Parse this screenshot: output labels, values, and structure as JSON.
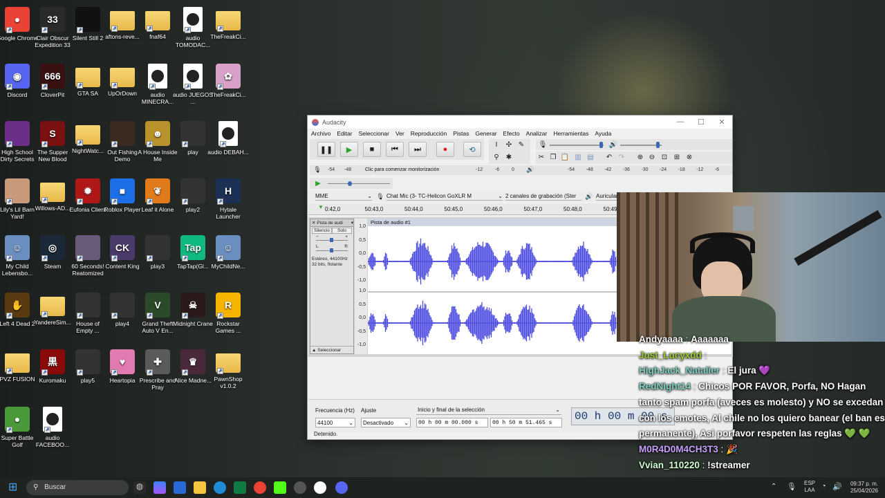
{
  "desktop": {
    "icons": [
      {
        "label": "Google Chrome",
        "glyph": "●",
        "color": "#ea4335"
      },
      {
        "label": "Clair Obscur Expedition 33",
        "glyph": "33",
        "color": "#2a2a2a"
      },
      {
        "label": "Silent Still 2",
        "glyph": "",
        "color": "#111111"
      },
      {
        "label": "aftons-reve...",
        "glyph": "",
        "color": "folder"
      },
      {
        "label": "fnaf64",
        "glyph": "",
        "color": "folder"
      },
      {
        "label": "audio TOMODAC...",
        "glyph": "",
        "color": "audio"
      },
      {
        "label": "TheFreakCi...",
        "glyph": "",
        "color": "folder"
      },
      {
        "label": "Discord",
        "glyph": "◉",
        "color": "#5865f2"
      },
      {
        "label": "CloverPit",
        "glyph": "666",
        "color": "#3a1111"
      },
      {
        "label": "GTA SA",
        "glyph": "",
        "color": "folder"
      },
      {
        "label": "UpOrDown",
        "glyph": "",
        "color": "folder"
      },
      {
        "label": "audio MINECRA...",
        "glyph": "",
        "color": "audio"
      },
      {
        "label": "audio JUEGOS ...",
        "glyph": "",
        "color": "audio"
      },
      {
        "label": "TheFreakCi...",
        "glyph": "✿",
        "color": "#d9a0c8"
      },
      {
        "label": "High School Dirty Secrets",
        "glyph": "",
        "color": "#6b2f8a"
      },
      {
        "label": "The Supper New Blood",
        "glyph": "S",
        "color": "#7a1010"
      },
      {
        "label": "NightWatc...",
        "glyph": "",
        "color": "folder"
      },
      {
        "label": "Out Fishing Demo",
        "glyph": "",
        "color": "#3a2a20"
      },
      {
        "label": "A House Inside Me",
        "glyph": "☻",
        "color": "#b8922a"
      },
      {
        "label": "play",
        "glyph": "",
        "color": "#333"
      },
      {
        "label": "audio DEBAH...",
        "glyph": "",
        "color": "audio"
      },
      {
        "label": "Lily's Lil Barn Yard!",
        "glyph": "",
        "color": "#c89a7a"
      },
      {
        "label": "Willows-AD...",
        "glyph": "",
        "color": "folder"
      },
      {
        "label": "Eufonia Client",
        "glyph": "✹",
        "color": "#b01818"
      },
      {
        "label": "Roblox Player",
        "glyph": "■",
        "color": "#1d6fe8"
      },
      {
        "label": "Leaf it Alone",
        "glyph": "❦",
        "color": "#e07a1a"
      },
      {
        "label": "play2",
        "glyph": "",
        "color": "#333"
      },
      {
        "label": "Hytale Launcher",
        "glyph": "H",
        "color": "#1c2f55"
      },
      {
        "label": "My Child Lebensbo...",
        "glyph": "☺",
        "color": "#6a8ec0"
      },
      {
        "label": "Steam",
        "glyph": "◎",
        "color": "#1b2838"
      },
      {
        "label": "60 Seconds! Reatomized",
        "glyph": "",
        "color": "#6a5a7a"
      },
      {
        "label": "Content King",
        "glyph": "CK",
        "color": "#4a3a6a"
      },
      {
        "label": "play3",
        "glyph": "",
        "color": "#333"
      },
      {
        "label": "TapTap(Gl...",
        "glyph": "Tap",
        "color": "#10b981"
      },
      {
        "label": "MyChildNe...",
        "glyph": "☺",
        "color": "#6a8ec0"
      },
      {
        "label": "Left 4 Dead 2",
        "glyph": "✋",
        "color": "#5a3a10"
      },
      {
        "label": "YandereSim...",
        "glyph": "",
        "color": "folder"
      },
      {
        "label": "House of Empty ...",
        "glyph": "",
        "color": "#333"
      },
      {
        "label": "play4",
        "glyph": "",
        "color": "#333"
      },
      {
        "label": "Grand Theft Auto V En...",
        "glyph": "V",
        "color": "#2a4a2a"
      },
      {
        "label": "Midnight Crane",
        "glyph": "☠",
        "color": "#2a1a1a"
      },
      {
        "label": "Rockstar Games ...",
        "glyph": "R",
        "color": "#f5b400"
      },
      {
        "label": "PVZ FUSION",
        "glyph": "",
        "color": "folder"
      },
      {
        "label": "Kuromaku",
        "glyph": "黒",
        "color": "#8a0a0a"
      },
      {
        "label": "play5",
        "glyph": "",
        "color": "#333"
      },
      {
        "label": "Heartopia",
        "glyph": "♥",
        "color": "#e07ab0"
      },
      {
        "label": "Prescribe and Pray",
        "glyph": "✚",
        "color": "#5a5a5a"
      },
      {
        "label": "Alice Madne...",
        "glyph": "♛",
        "color": "#4a2a3a"
      },
      {
        "label": "PawnShop v1.0.2",
        "glyph": "",
        "color": "folder"
      },
      {
        "label": "Super Battle Golf",
        "glyph": "●",
        "color": "#4a9a3a"
      },
      {
        "label": "audio FACEBOO...",
        "glyph": "",
        "color": "audio"
      }
    ]
  },
  "audacity": {
    "title": "Audacity",
    "menu": [
      "Archivo",
      "Editar",
      "Seleccionar",
      "Ver",
      "Reproducción",
      "Pistas",
      "Generar",
      "Efecto",
      "Analizar",
      "Herramientas",
      "Ayuda"
    ],
    "meter_hint": "Clic para comenzar monitorización",
    "rec_meter_ticks": [
      "-54",
      "-48",
      "-12",
      "-6",
      "0"
    ],
    "play_meter_ticks": [
      "-54",
      "-48",
      "-42",
      "-36",
      "-30",
      "-24",
      "-18",
      "-12",
      "-6",
      "0"
    ],
    "host": "MME",
    "mic": "Chat Mic (3- TC-Helicon GoXLR M",
    "channels": "2 canales de grabación (Ster",
    "output": "Auricular",
    "timeline": [
      "0:42,0",
      "50:43,0",
      "50:44,0",
      "50:45,0",
      "50:46,0",
      "50:47,0",
      "50:48,0",
      "50:49,0"
    ],
    "track": {
      "name": "Pista de audi",
      "clip_name": "Pista de audio #1",
      "mute": "Silencio",
      "solo": "Solo",
      "info": "Estéreo, 44100Hz 32 bits, flotante",
      "select": "Seleccionar",
      "scale": [
        "1,0",
        "0,5",
        "0,0",
        "-0,5",
        "-1,0",
        "1,0",
        "0,5",
        "0,0",
        "-0,5",
        "-1,0"
      ]
    },
    "bottom": {
      "rate_label": "Frecuencia (Hz)",
      "snap_label": "Ajuste",
      "rate_value": "44100",
      "snap_value": "Desactivado",
      "sel_mode": "Inicio y final de la selección",
      "sel_start": "00 h 00 m 00.000 s",
      "sel_end": "00 h 50 m 51.465 s",
      "big_time": "00 h 00 m 00 s"
    },
    "status": "Detenido."
  },
  "chat": [
    {
      "name": "Andyaaaa",
      "text": "Aaaaaaa",
      "color": "#ffffff"
    },
    {
      "name": "Just_Lucyxdd",
      "text": "",
      "color": "#9acd32"
    },
    {
      "name": "HighJack_Natalier",
      "text": "El jura 💜",
      "color": "#7ecfc0"
    },
    {
      "name": "RedNight14",
      "text": "Chicos POR FAVOR, Porfa, NO Hagan tanto spam porfa (aveces es molesto) y NO se excedan con los emotes, Al chile no los quiero banear (el ban es permanente), Asi porfavor respeten las reglas 💚 💚",
      "color": "#7ecfc0"
    },
    {
      "name": "M0R4D0M4CH3T3",
      "text": "🎉",
      "color": "#c8a0ff"
    },
    {
      "name": "Vvian_110220",
      "text": "!streamer",
      "color": "#d0ffd0"
    }
  ],
  "taskbar": {
    "search": "Buscar",
    "lang": "ESP LAA",
    "time": "09:37 p. m.",
    "date": "25/04/2026"
  }
}
